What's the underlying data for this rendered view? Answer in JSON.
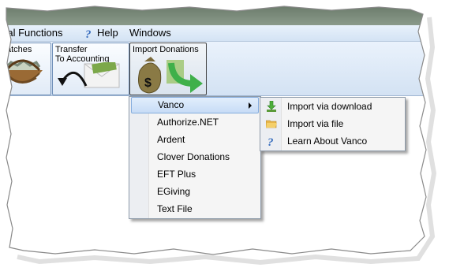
{
  "menubar": {
    "items": [
      {
        "label": "cial Functions"
      },
      {
        "label": "Help",
        "icon": "help-icon"
      },
      {
        "label": "Windows"
      }
    ]
  },
  "toolbar": {
    "buttons": [
      {
        "label_line1": "atches",
        "label_line2": "",
        "icon": "basket-icon"
      },
      {
        "label_line1": "Transfer",
        "label_line2": "To Accounting",
        "icon": "transfer-envelope-icon"
      },
      {
        "label_line1": "Import Donations",
        "label_line2": "",
        "icon": "money-bag-arrow-icon"
      }
    ]
  },
  "dropdown": {
    "items": [
      {
        "label": "Vanco",
        "selected": true,
        "has_submenu": true
      },
      {
        "label": "Authorize.NET"
      },
      {
        "label": "Ardent"
      },
      {
        "label": "Clover Donations"
      },
      {
        "label": "EFT Plus"
      },
      {
        "label": "EGiving"
      },
      {
        "label": "Text File"
      }
    ]
  },
  "submenu": {
    "items": [
      {
        "label": "Import via download",
        "icon": "download-icon"
      },
      {
        "label": "Import via file",
        "icon": "folder-icon"
      },
      {
        "label": "Learn About Vanco",
        "icon": "question-icon"
      }
    ]
  },
  "colors": {
    "titlebar": "#728272",
    "menubar": "#dbe8f6",
    "selection": "#c7dcf6",
    "selection_border": "#84acdd"
  }
}
